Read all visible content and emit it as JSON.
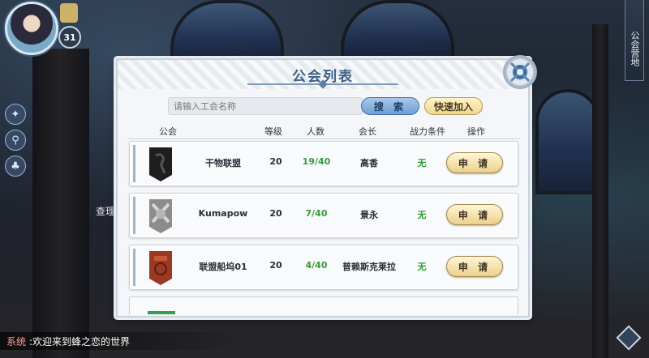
{
  "hud": {
    "player_level": "31",
    "side_tab": "公会营地",
    "side_text": "查理",
    "chat_tag": "系统",
    "chat_message": ":欢迎来到蜂之恋的世界"
  },
  "modal": {
    "title": "公会列表",
    "search_placeholder": "请输入工会名称",
    "search_value": "",
    "search_button": "搜 索",
    "quick_join_button": "快速加入",
    "columns": {
      "guild": "公会",
      "level": "等级",
      "members": "人数",
      "leader": "会长",
      "power": "战力条件",
      "action": "操作"
    },
    "rows": [
      {
        "name": "干物联盟",
        "level": "20",
        "members": "19/40",
        "leader": "高香",
        "power": "无",
        "action": "申 请",
        "emblem_color": "#1e1e1e"
      },
      {
        "name": "Kumapow",
        "level": "20",
        "members": "7/40",
        "leader": "景永",
        "power": "无",
        "action": "申 请",
        "emblem_color": "#8c8c8c"
      },
      {
        "name": "联盟船坞01",
        "level": "20",
        "members": "4/40",
        "leader": "普赖斯克莱拉",
        "power": "无",
        "action": "申 请",
        "emblem_color": "#9b3a22"
      }
    ]
  },
  "colors": {
    "title": "#3d5f86",
    "members": "#3a9b3a",
    "search_button": "#6d9ed6",
    "gold_button": "#ecd08b"
  }
}
